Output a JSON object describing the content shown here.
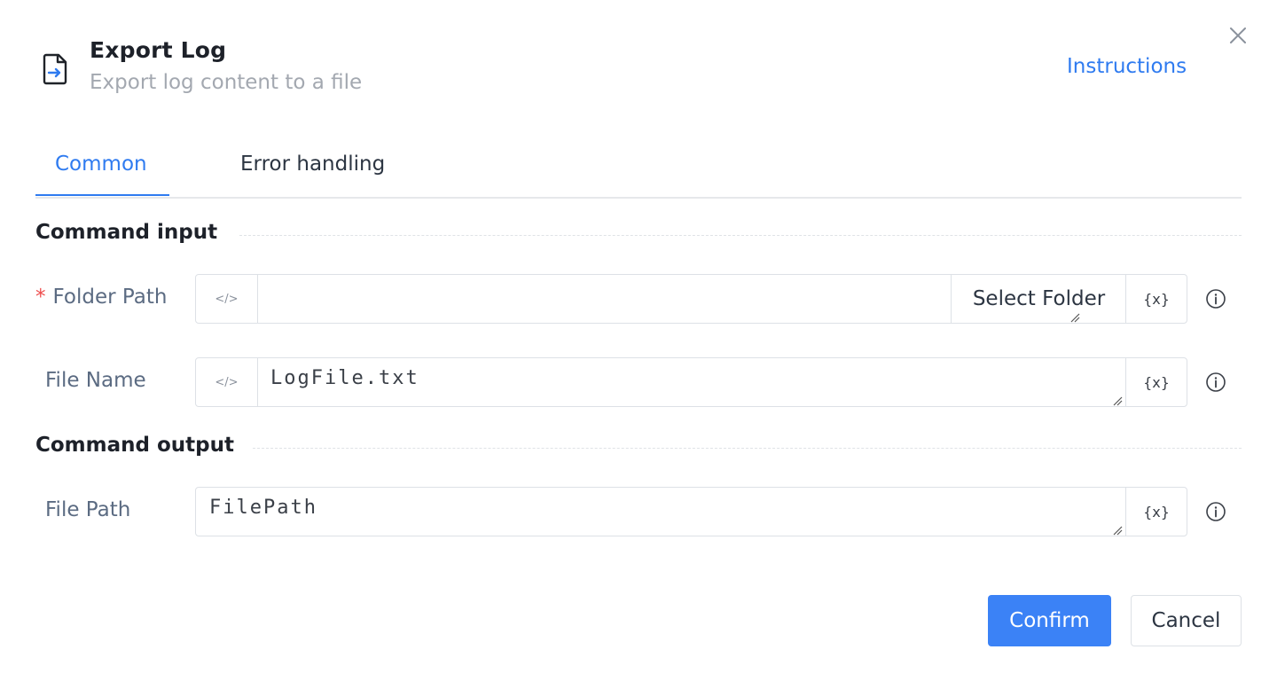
{
  "header": {
    "title": "Export Log",
    "subtitle": "Export log content to a file",
    "instructions_label": "Instructions",
    "icon": "file-export-icon"
  },
  "tabs": [
    {
      "label": "Common",
      "active": true
    },
    {
      "label": "Error handling",
      "active": false
    }
  ],
  "sections": {
    "input_title": "Command input",
    "output_title": "Command output"
  },
  "fields": {
    "folder_path": {
      "label": "Folder Path",
      "required": true,
      "required_mark": "*",
      "value": "",
      "code_toggle": "</>",
      "select_folder_label": "Select Folder",
      "var_label": "{x}"
    },
    "file_name": {
      "label": "File Name",
      "value": "LogFile.txt",
      "code_toggle": "</>",
      "var_label": "{x}"
    },
    "file_path": {
      "label": "File Path",
      "value": "FilePath",
      "var_label": "{x}"
    }
  },
  "footer": {
    "confirm_label": "Confirm",
    "cancel_label": "Cancel"
  },
  "colors": {
    "accent": "#2f7bf0",
    "confirm_bg": "#3b82f6",
    "required": "#ee4d4d"
  }
}
